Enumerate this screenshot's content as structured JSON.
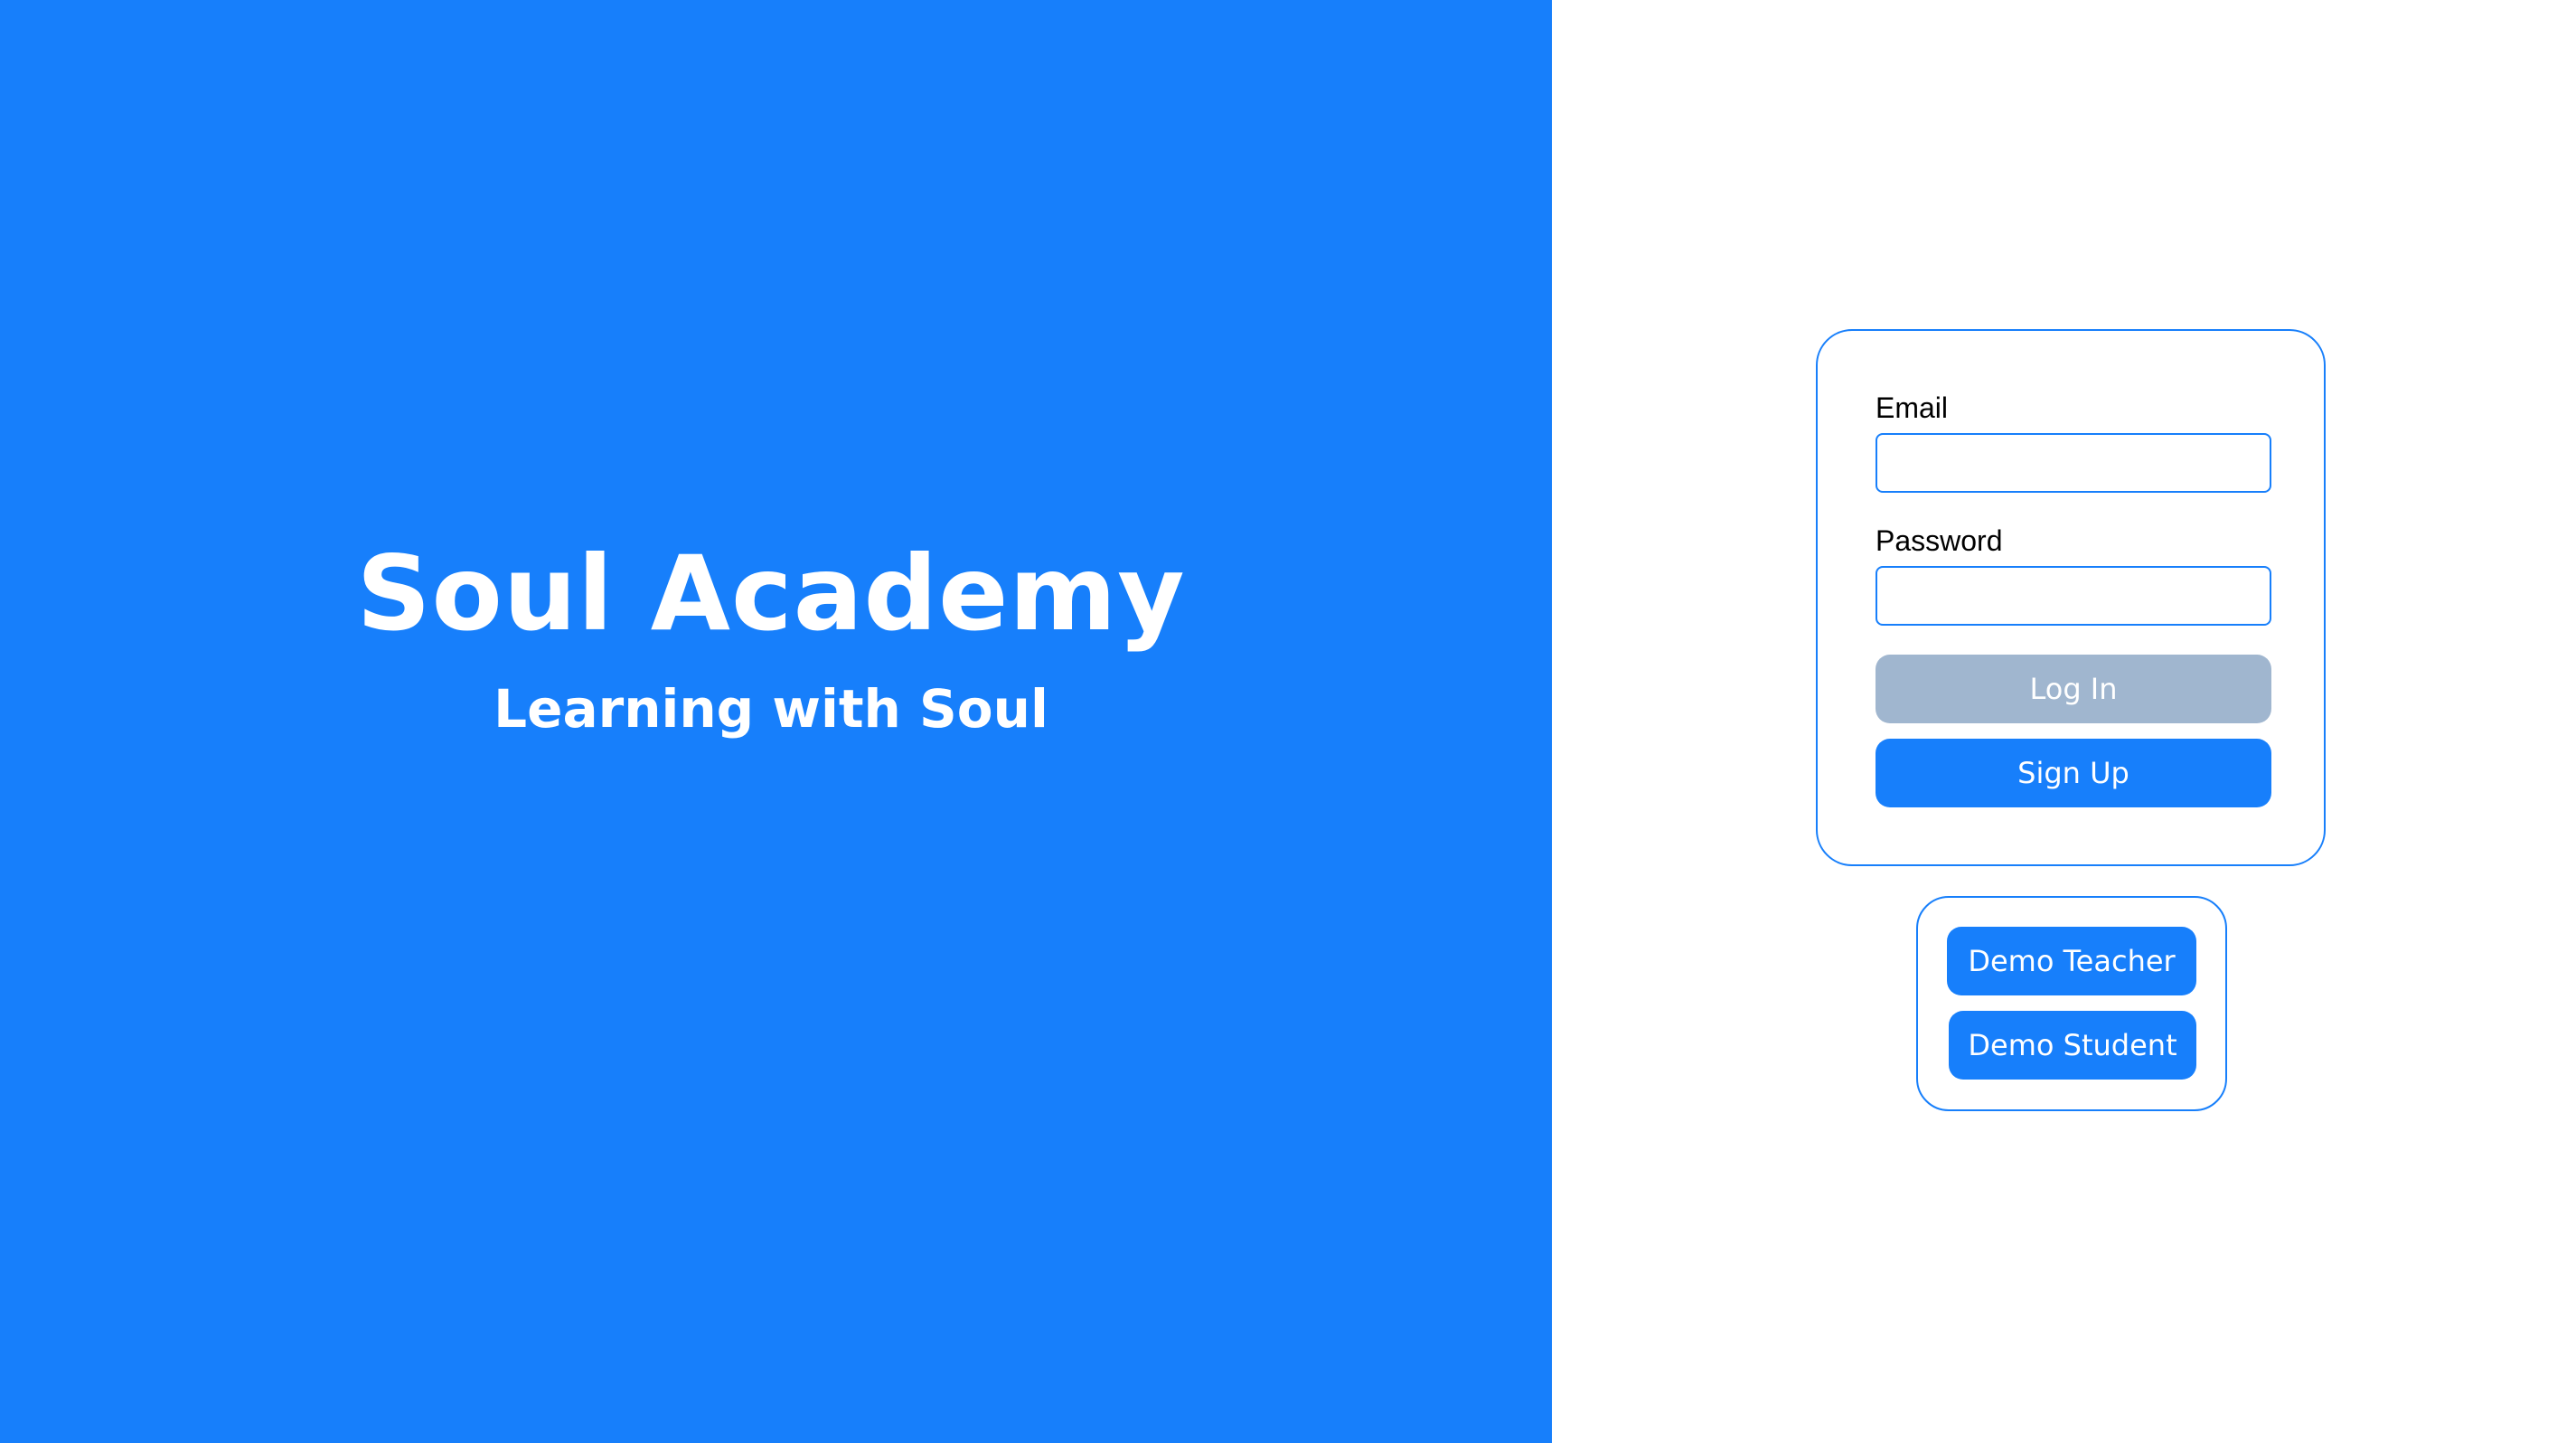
{
  "brand": {
    "title": "Soul Academy",
    "subtitle": "Learning with Soul"
  },
  "login_form": {
    "email_label": "Email",
    "email_value": "",
    "password_label": "Password",
    "password_value": "",
    "login_button": "Log In",
    "signup_button": "Sign Up"
  },
  "demo": {
    "teacher_button": "Demo Teacher",
    "student_button": "Demo Student"
  },
  "colors": {
    "brand_blue": "#177ffb",
    "disabled_button": "#a0b6cf",
    "background": "#ffffff"
  }
}
